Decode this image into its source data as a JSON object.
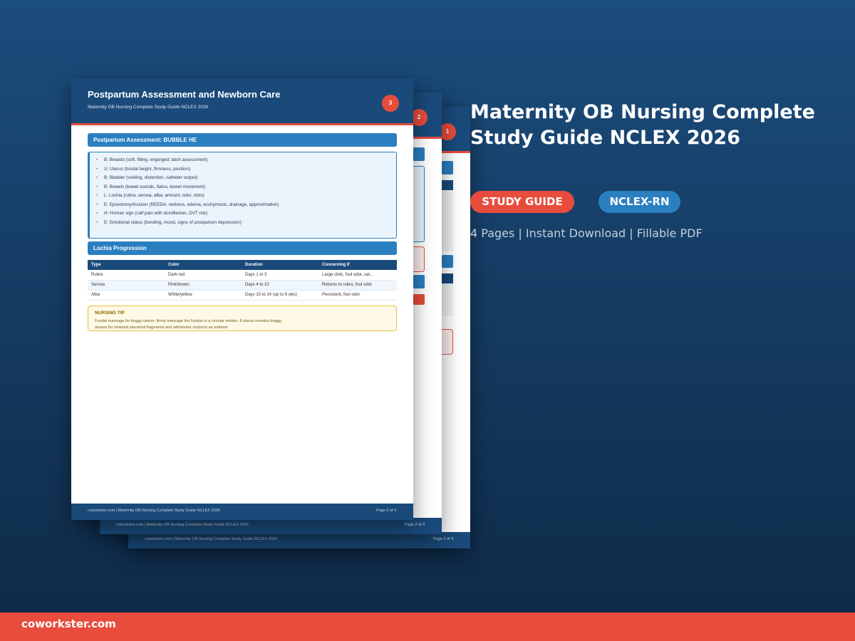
{
  "product": {
    "title": "Maternity OB Nursing Complete Study Guide NCLEX 2026",
    "badges": [
      "STUDY GUIDE",
      "NCLEX-RN"
    ],
    "meta": "4 Pages | Instant Download | Fillable PDF"
  },
  "brand": "coworkster.com",
  "colors": {
    "navy": "#1a4a7a",
    "accent_red": "#e74c3c",
    "blue": "#2a7fc1",
    "tip_yellow": "#e8c13a"
  },
  "pages": {
    "page1": {
      "number": "1",
      "footer_left": "coworkster.com | Maternity OB Nursing Complete Study Guide NCLEX 2026",
      "footer_right": "Page 1 of 4"
    },
    "page2": {
      "number": "2",
      "footer_left": "coworkster.com | Maternity OB Nursing Complete Study Guide NCLEX 2026",
      "footer_right": "Page 2 of 4"
    },
    "page3": {
      "number": "3",
      "title": "Postpartum Assessment and Newborn Care",
      "subtitle": "Maternity OB Nursing Complete Study Guide NCLEX 2026",
      "section1": "Postpartum Assessment: BUBBLE HE",
      "bubble_items": [
        "B: Breasts (soft, filling, engorged; latch assessment)",
        "U: Uterus (fundal height, firmness, position)",
        "B: Bladder (voiding, distention, catheter output)",
        "B: Bowels (bowel sounds, flatus, bowel movement)",
        "L: Lochia (rubra, serosa, alba; amount, odor, clots)",
        "E: Episiotomy/Incision (REEDA: redness, edema, ecchymosis, drainage, approximation)",
        "H: Homan sign (calf pain with dorsiflexion, DVT risk)",
        "E: Emotional status (bonding, mood, signs of postpartum depression)"
      ],
      "section2": "Lochia Progression",
      "table": {
        "headers": [
          "Type",
          "Color",
          "Duration",
          "Concerning If"
        ],
        "rows": [
          [
            "Rubra",
            "Dark red",
            "Days 1 to 3",
            "Large clots, foul odor, sat..."
          ],
          [
            "Serosa",
            "Pink/brown",
            "Days 4 to 10",
            "Returns to rubra, foul odor"
          ],
          [
            "Alba",
            "White/yellow",
            "Days 10 to 14 (up to 6 wks)",
            "Persistent, foul odor"
          ]
        ]
      },
      "tip_heading": "NURSING TIP",
      "tip_text": "Fundal massage for boggy uterus: firmly massage the fundus in a circular motion. If uterus remains boggy, assess for retained placental fragments and administer oxytocin as ordered",
      "footer_left": "coworkster.com | Maternity OB Nursing Complete Study Guide NCLEX 2026",
      "footer_right": "Page 3 of 4"
    }
  }
}
